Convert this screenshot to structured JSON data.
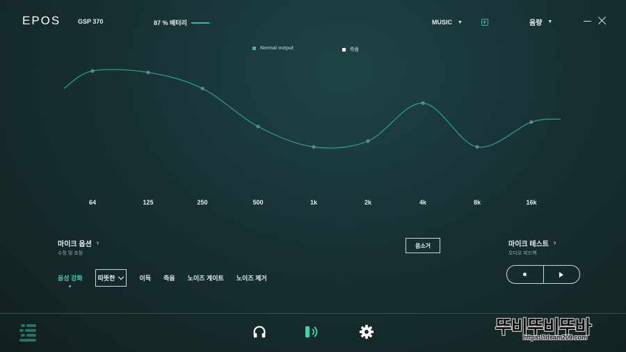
{
  "header": {
    "logo": "EPOS",
    "device": "GSP 370",
    "battery_label": "87 % 배터리",
    "battery_level": 0.87,
    "preset": "MUSIC",
    "volume_label": "음량"
  },
  "legend": {
    "normal": "Normal output",
    "side": "측음",
    "normal_color": "#3fb8a0",
    "side_color": "#ffffff"
  },
  "chart_data": {
    "type": "line",
    "categories": [
      "64",
      "125",
      "250",
      "500",
      "1k",
      "2k",
      "4k",
      "8k",
      "16k"
    ],
    "series": [
      {
        "name": "Normal output",
        "values": [
          4.0,
          3.9,
          2.8,
          0.2,
          -1.2,
          -0.8,
          1.8,
          -1.2,
          0.5
        ]
      }
    ],
    "ylim": [
      -4,
      6
    ],
    "grid": false,
    "legend_position": "top-center",
    "line_color": "#2f9c8a"
  },
  "mic_options": {
    "title": "마이크 옵션",
    "subtitle": "수정 및 조정",
    "help": "?"
  },
  "mute_button": "음소거",
  "mic_test": {
    "title": "마이크 테스트",
    "subtitle": "오디오 피드백",
    "help": "?"
  },
  "tabs": {
    "voice_enhance": "음성 강화",
    "warm_select": "따뜻한",
    "gain": "이득",
    "sidetone": "측음",
    "noise_gate": "노이즈 게이트",
    "noise_removal": "노이즈 제거"
  },
  "watermark": {
    "text": "뚜비뚜비뚜바",
    "url": "https://idsam209.com"
  }
}
